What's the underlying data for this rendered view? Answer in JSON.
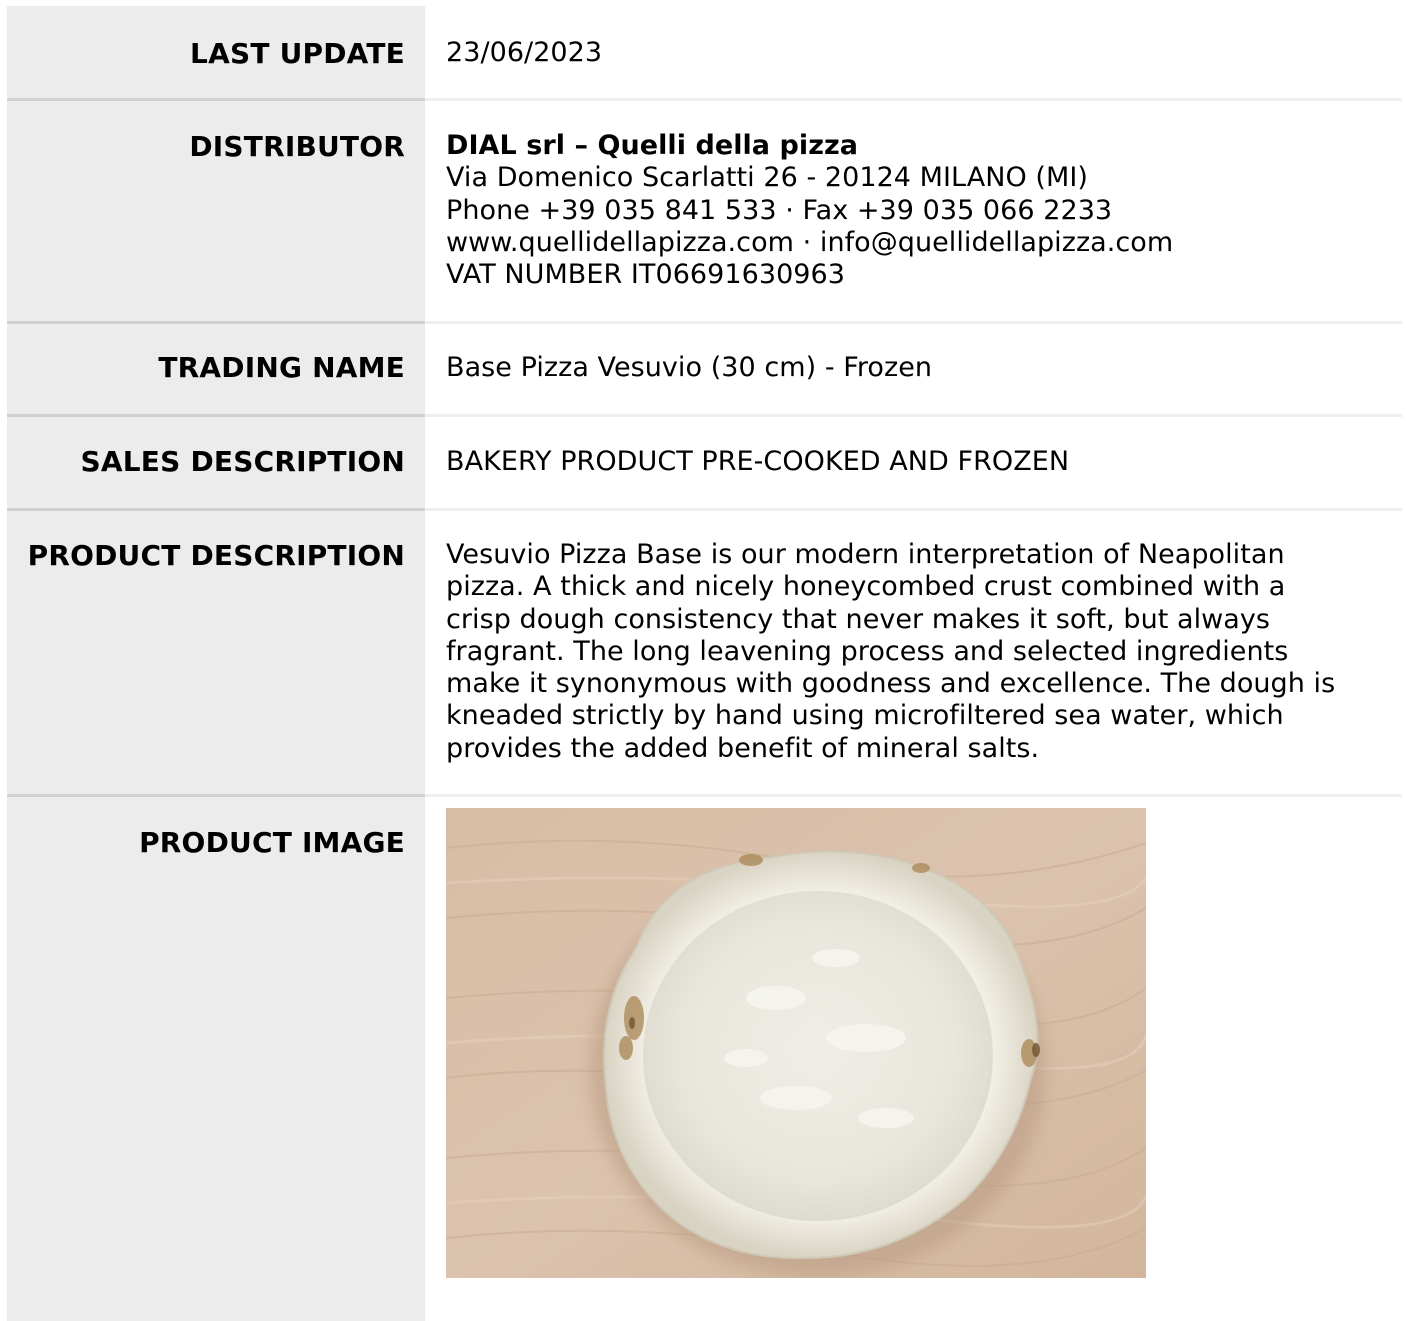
{
  "rows": {
    "last_update": {
      "label": "LAST UPDATE",
      "value": "23/06/2023"
    },
    "distributor": {
      "label": "DISTRIBUTOR",
      "name": "DIAL srl – Quelli della pizza",
      "address": "Via Domenico Scarlatti 26 - 20124 MILANO (MI)",
      "phone_fax": "Phone +39 035 841 533 · Fax +39 035 066 2233",
      "web_email": "www.quellidellapizza.com · info@quellidellapizza.com",
      "vat": "VAT NUMBER IT06691630963"
    },
    "trading_name": {
      "label": "TRADING NAME",
      "value": "Base Pizza Vesuvio (30 cm) - Frozen"
    },
    "sales_description": {
      "label": "SALES DESCRIPTION",
      "value": "BAKERY PRODUCT PRE-COOKED AND FROZEN"
    },
    "product_description": {
      "label": "PRODUCT DESCRIPTION",
      "lines": [
        "Vesuvio Pizza Base is our modern interpretation of Neapolitan",
        "pizza. A thick and nicely honeycombed crust combined with a",
        "crisp dough consistency that never makes it soft, but always",
        "fragrant. The long leavening process and selected ingredients",
        "make it synonymous with goodness and excellence. The dough is",
        "kneaded strictly by hand using microfiltered sea water, which",
        "provides the added benefit of mineral salts."
      ]
    },
    "product_image": {
      "label": "PRODUCT IMAGE"
    }
  },
  "colors": {
    "label_bg": "#ececec",
    "divider_left": "#d0d0d0",
    "divider_right": "#efefef",
    "wood": "#dcc3ad",
    "dough": "#eeebe1"
  }
}
